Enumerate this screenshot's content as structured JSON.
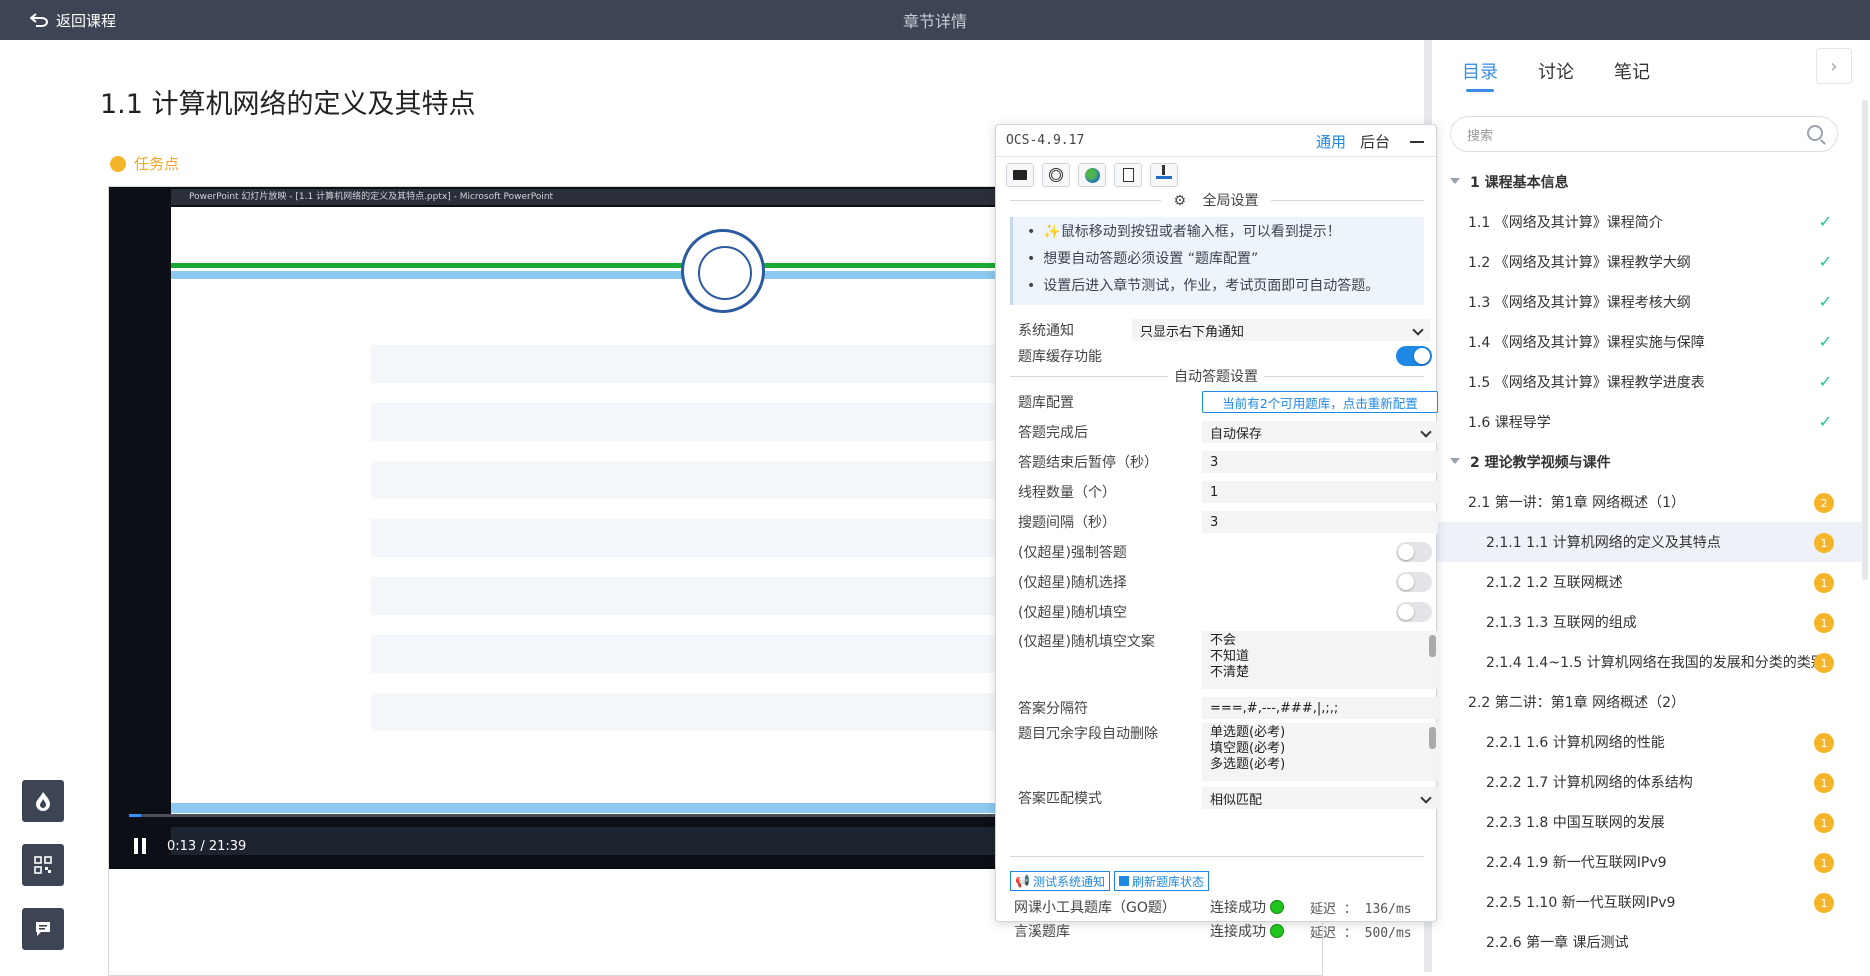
{
  "header": {
    "back_label": "返回课程",
    "title": "章节详情"
  },
  "lesson": {
    "title": "1.1 计算机网络的定义及其特点",
    "task_point": "任务点"
  },
  "video": {
    "ppt_title": "PowerPoint 幻灯片放映 - [1.1 计算机网络的定义及其特点.pptx] - Microsoft PowerPoint",
    "time": "0:13 / 21:39",
    "progress": 0.01
  },
  "right_panel": {
    "tabs": [
      "目录",
      "讨论",
      "笔记"
    ],
    "active_tab": "目录",
    "search_placeholder": "搜索",
    "toc": [
      {
        "label": "1 课程基本信息",
        "type": "section"
      },
      {
        "label": "1.1 《网络及其计算》课程简介",
        "type": "lv1",
        "status": "done"
      },
      {
        "label": "1.2 《网络及其计算》课程教学大纲",
        "type": "lv1",
        "status": "done"
      },
      {
        "label": "1.3 《网络及其计算》课程考核大纲",
        "type": "lv1",
        "status": "done"
      },
      {
        "label": "1.4 《网络及其计算》课程实施与保障",
        "type": "lv1",
        "status": "done"
      },
      {
        "label": "1.5 《网络及其计算》课程教学进度表",
        "type": "lv1",
        "status": "done"
      },
      {
        "label": "1.6 课程导学",
        "type": "lv1",
        "status": "done"
      },
      {
        "label": "2 理论教学视频与课件",
        "type": "section"
      },
      {
        "label": "2.1 第一讲：第1章 网络概述（1）",
        "type": "lv1",
        "badge": "2"
      },
      {
        "label": "2.1.1 1.1 计算机网络的定义及其特点",
        "type": "lv2",
        "badge": "1",
        "active": true
      },
      {
        "label": "2.1.2 1.2 互联网概述",
        "type": "lv2",
        "badge": "1"
      },
      {
        "label": "2.1.3 1.3 互联网的组成",
        "type": "lv2",
        "badge": "1"
      },
      {
        "label": "2.1.4 1.4~1.5 计算机网络在我国的发展和分类的类别",
        "type": "lv2",
        "badge": "1"
      },
      {
        "label": "2.2 第二讲：第1章 网络概述（2）",
        "type": "lv1"
      },
      {
        "label": "2.2.1 1.6 计算机网络的性能",
        "type": "lv2",
        "badge": "1"
      },
      {
        "label": "2.2.2 1.7 计算机网络的体系结构",
        "type": "lv2",
        "badge": "1"
      },
      {
        "label": "2.2.3 1.8 中国互联网的发展",
        "type": "lv2",
        "badge": "1"
      },
      {
        "label": "2.2.4 1.9 新一代互联网IPv9",
        "type": "lv2",
        "badge": "1"
      },
      {
        "label": "2.2.5 1.10 新一代互联网IPv9",
        "type": "lv2",
        "badge": "1"
      },
      {
        "label": "2.2.6 第一章 课后测试",
        "type": "lv2"
      }
    ]
  },
  "ocs": {
    "version": "OCS-4.9.17",
    "nav": {
      "general": "通用",
      "backend": "后台"
    },
    "global_settings": "全局设置",
    "tips": [
      "✨鼠标移动到按钮或者输入框，可以看到提示！",
      "想要自动答题必须设置 “题库配置”",
      "设置后进入章节测试，作业，考试页面即可自动答题。"
    ],
    "system_notice_label": "系统通知",
    "system_notice_value": "只显示右下角通知",
    "cache_label": "题库缓存功能",
    "auto_answer_settings": "自动答题设置",
    "bank_config_label": "题库配置",
    "bank_config_button": "当前有2个可用题库，点击重新配置",
    "after_answer_label": "答题完成后",
    "after_answer_value": "自动保存",
    "pause_label": "答题结束后暂停（秒）",
    "pause_value": "3",
    "threads_label": "线程数量（个）",
    "threads_value": "1",
    "interval_label": "搜题间隔（秒）",
    "interval_value": "3",
    "force_answer_label": "(仅超星)强制答题",
    "random_select_label": "(仅超星)随机选择",
    "random_fill_label": "(仅超星)随机填空",
    "random_fill_text_label": "(仅超星)随机填空文案",
    "random_fill_text": [
      "不会",
      "不知道",
      "不清楚"
    ],
    "separator_label": "答案分隔符",
    "separator_value": "===,#,---,###,|,;,;",
    "redundant_label": "题目冗余字段自动删除",
    "redundant_values": [
      "单选题(必考)",
      "填空题(必考)",
      "多选题(必考)"
    ],
    "match_label": "答案匹配模式",
    "match_value": "相似匹配",
    "test_notice_button": "测试系统通知",
    "refresh_bank_button": "刷新题库状态",
    "banks": [
      {
        "name": "网课小工具题库（GO题）",
        "status": "连接成功",
        "latency": "延迟 ： 136/ms"
      },
      {
        "name": "言溪题库",
        "status": "连接成功",
        "latency": "延迟 ： 500/ms"
      }
    ]
  }
}
